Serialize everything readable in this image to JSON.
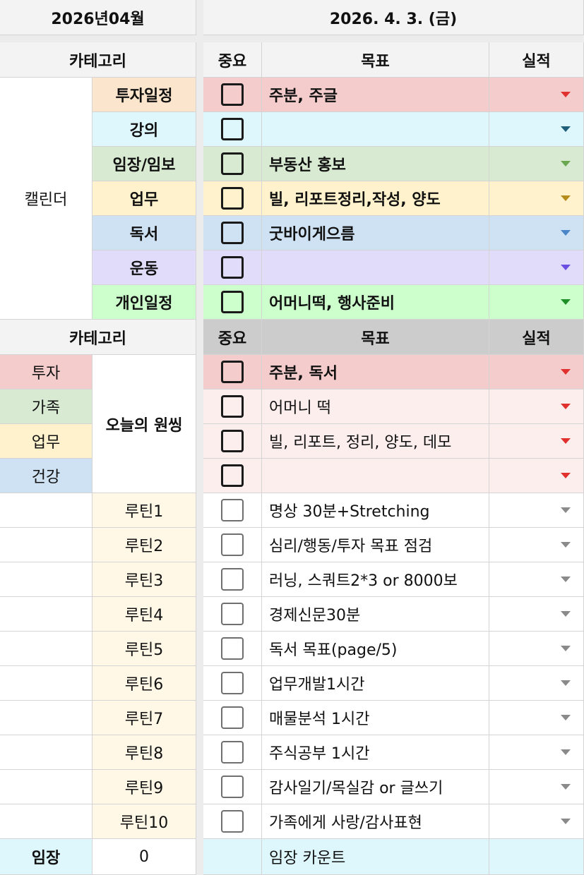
{
  "header": {
    "month": "2026년04월",
    "date": "2026. 4. 3. (금)"
  },
  "columns": {
    "category": "카테고리",
    "important": "중요",
    "goal": "목표",
    "result": "실적"
  },
  "calendar": {
    "label": "캘린더",
    "rows": [
      {
        "category": "투자일정",
        "goal": "주분, 주글",
        "cat_color": "#fce5cd",
        "row_color": "#f4cccc",
        "arrow_color": "#e0312e"
      },
      {
        "category": "강의",
        "goal": "",
        "cat_color": "#ddf7fd",
        "row_color": "#ddf7fd",
        "arrow_color": "#1f5f7a"
      },
      {
        "category": "임장/임보",
        "goal": "부동산 홍보",
        "cat_color": "#d9ead3",
        "row_color": "#d9ead3",
        "arrow_color": "#6aa84f"
      },
      {
        "category": "업무",
        "goal": "빌, 리포트정리,작성, 양도",
        "cat_color": "#fff2cc",
        "row_color": "#fff2cc",
        "arrow_color": "#b58b1c"
      },
      {
        "category": "독서",
        "goal": "굿바이게으름",
        "cat_color": "#cfe2f3",
        "row_color": "#cfe2f3",
        "arrow_color": "#4a86c8"
      },
      {
        "category": "운동",
        "goal": "",
        "cat_color": "#e2dcfb",
        "row_color": "#e2dcfb",
        "arrow_color": "#6a4fe0"
      },
      {
        "category": "개인일정",
        "goal": "어머니떡, 행사준비",
        "cat_color": "#ccffcc",
        "row_color": "#ccffcc",
        "arrow_color": "#1f8f2a"
      }
    ]
  },
  "wishing": {
    "label": "오늘의 원씽",
    "categories": [
      {
        "name": "투자",
        "color": "#f4cccc"
      },
      {
        "name": "가족",
        "color": "#d9ead3"
      },
      {
        "name": "업무",
        "color": "#fff2cc"
      },
      {
        "name": "건강",
        "color": "#cfe2f3"
      }
    ],
    "rows": [
      {
        "goal": "주분, 독서",
        "bold": true,
        "color": "#f4cccc"
      },
      {
        "goal": "어머니 떡",
        "bold": false,
        "color": "#fdeeee"
      },
      {
        "goal": "빌, 리포트, 정리, 양도, 데모",
        "bold": false,
        "color": "#fdeeee"
      },
      {
        "goal": "",
        "bold": false,
        "color": "#fdeeee"
      }
    ],
    "arrow_color": "#e0312e"
  },
  "routines": [
    {
      "name": "루틴1",
      "goal": "명상 30분+Stretching"
    },
    {
      "name": "루틴2",
      "goal": "심리/행동/투자 목표 점검"
    },
    {
      "name": "루틴3",
      "goal": "러닝, 스쿼트2*3 or 8000보"
    },
    {
      "name": "루틴4",
      "goal": "경제신문30분"
    },
    {
      "name": "루틴5",
      "goal": "독서 목표(page/5)"
    },
    {
      "name": "루틴6",
      "goal": "업무개발1시간"
    },
    {
      "name": "루틴7",
      "goal": "매물분석 1시간"
    },
    {
      "name": "루틴8",
      "goal": "주식공부 1시간"
    },
    {
      "name": "루틴9",
      "goal": "감사일기/목실감 or 글쓰기"
    },
    {
      "name": "루틴10",
      "goal": "가족에게 사랑/감사표현"
    }
  ],
  "imjang": {
    "label": "임장",
    "count": "0",
    "goal": "임장 카운트"
  },
  "colors": {
    "header_bg": "#f3f3f3",
    "subheader_bg": "#cccccc",
    "routine_cat_bg": "#fff8e6",
    "imjang_bg": "#ddf7fd",
    "gray_arrow": "#8a8a8a"
  }
}
